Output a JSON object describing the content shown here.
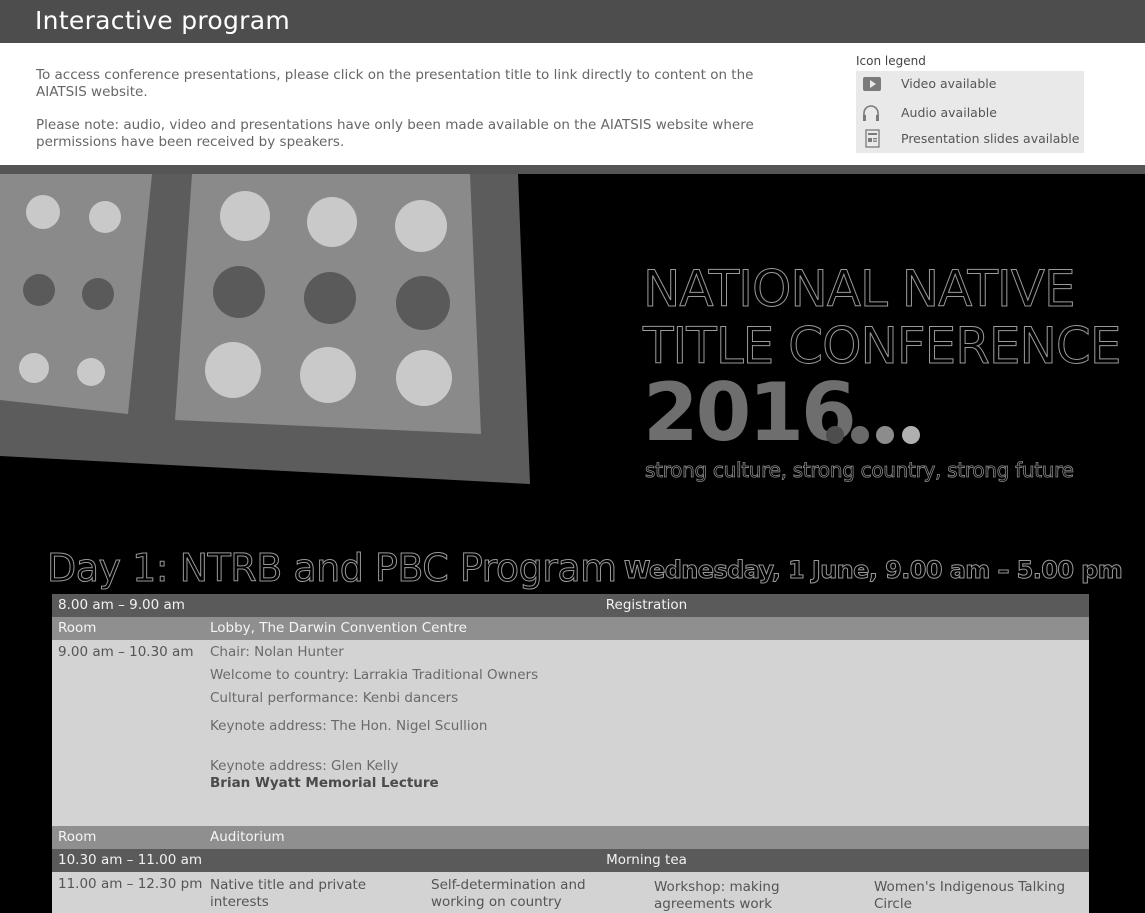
{
  "header": {
    "title": "Interactive program"
  },
  "intro": {
    "para1": "To access conference presentations, please click on the presentation title to link directly to content on the AIATSIS website.",
    "para2": "Please note: audio, video and presentations have only been made available on the AIATSIS website where permissions have been received by speakers."
  },
  "legend": {
    "title": "Icon legend",
    "items": [
      {
        "icon": "video-icon",
        "label": "Video available"
      },
      {
        "icon": "headphones-icon",
        "label": "Audio available"
      },
      {
        "icon": "slides-icon",
        "label": "Presentation slides available"
      }
    ]
  },
  "banner": {
    "line1": "NATIONAL NATIVE",
    "line2": "TITLE CONFERENCE",
    "year": "2016",
    "tagline": "strong culture, strong country, strong future"
  },
  "day": {
    "title": "Day 1: NTRB and PBC Program",
    "date": "Wednesday,  1 June, 9.00 am – 5.00 pm"
  },
  "program": {
    "registration": {
      "time": "8.00 am – 9.00 am",
      "label": "Registration"
    },
    "room1": {
      "label": "Room",
      "value": "Lobby, The Darwin Convention Centre"
    },
    "opening": {
      "time": "9.00 am – 10.30 am",
      "lines": [
        "Chair: Nolan Hunter",
        "Welcome to country: Larrakia Traditional Owners",
        "Cultural performance: Kenbi dancers",
        "Keynote address: The Hon. Nigel Scullion",
        "Keynote address: Glen Kelly"
      ],
      "bold_line": "Brian Wyatt Memorial Lecture"
    },
    "room2": {
      "label": "Room",
      "value": "Auditorium"
    },
    "tea": {
      "time": "10.30 am – 11.00 am",
      "label": "Morning tea"
    },
    "parallel": {
      "time": "11.00 am – 12.30 pm",
      "sessions": [
        "Native title and private interests",
        "Self-determination and working on country",
        "Workshop: making agreements work",
        "Women's Indigenous Talking Circle"
      ]
    }
  }
}
